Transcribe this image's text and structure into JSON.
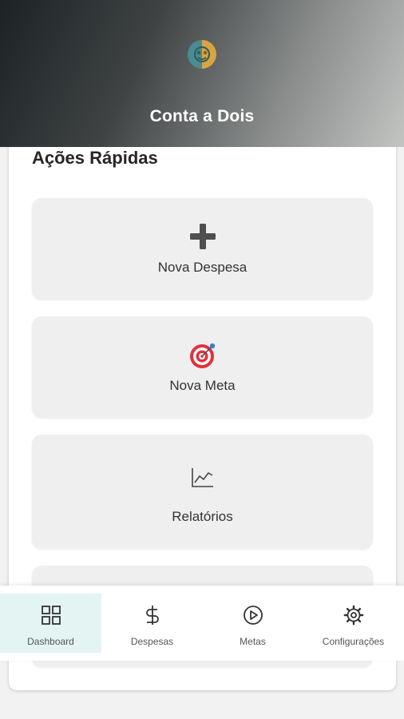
{
  "app": {
    "title": "Conta a Dois"
  },
  "quick_actions": {
    "title": "Ações Rápidas",
    "items": [
      {
        "label": "Nova Despesa",
        "icon": "plus-icon"
      },
      {
        "label": "Nova Meta",
        "icon": "target-icon"
      },
      {
        "label": "Relatórios",
        "icon": "chart-line-icon"
      }
    ]
  },
  "nav": {
    "items": [
      {
        "label": "Dashboard",
        "icon": "grid-icon",
        "active": true
      },
      {
        "label": "Despesas",
        "icon": "dollar-icon",
        "active": false
      },
      {
        "label": "Metas",
        "icon": "play-circle-icon",
        "active": false
      },
      {
        "label": "Configurações",
        "icon": "gear-icon",
        "active": false
      }
    ]
  },
  "colors": {
    "accent": "#e3f4f3",
    "target_red": "#e2313b",
    "logo_teal": "#4b8b93",
    "logo_gold": "#d9a441"
  }
}
